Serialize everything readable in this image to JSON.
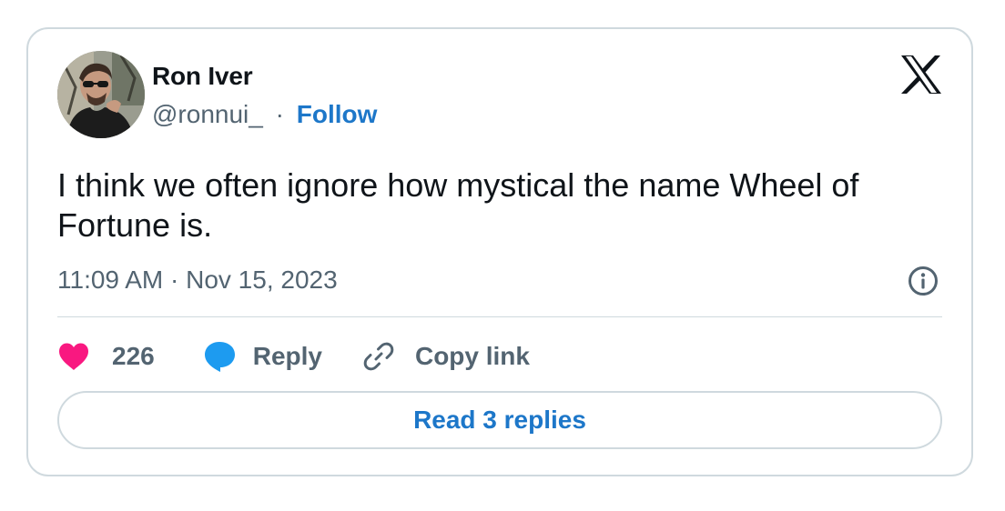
{
  "author": {
    "name": "Ron Iver",
    "handle": "@ronnui_",
    "separator": "·",
    "follow_label": "Follow",
    "avatar_icon": "profile-photo"
  },
  "brand": {
    "logo_icon": "x-logo-icon"
  },
  "tweet": {
    "text": "I think we often ignore how mystical the name Wheel of Fortune is.",
    "timestamp": "11:09 AM · Nov 15, 2023",
    "info_icon": "info-icon"
  },
  "actions": {
    "like": {
      "icon": "heart-icon",
      "count": "226",
      "color": "#f91880"
    },
    "reply": {
      "icon": "speech-bubble-icon",
      "label": "Reply",
      "color": "#1d9bf0"
    },
    "copy": {
      "icon": "link-icon",
      "label": "Copy link"
    }
  },
  "footer": {
    "read_replies_label": "Read 3 replies"
  },
  "colors": {
    "text_primary": "#0f1419",
    "text_secondary": "#536471",
    "accent_link": "#1d77c9",
    "border": "#cfd9de"
  }
}
